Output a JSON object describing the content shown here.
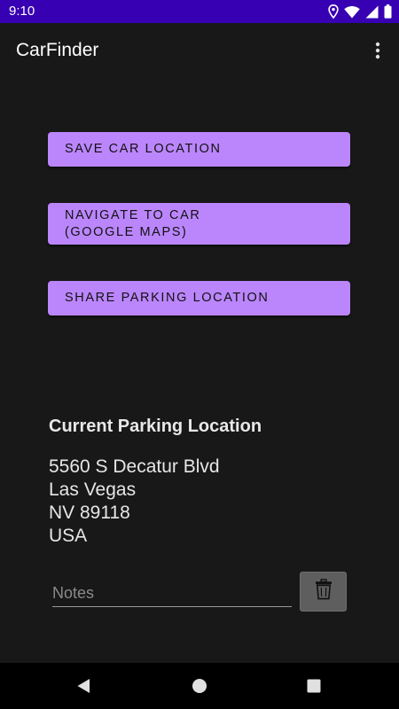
{
  "status_bar": {
    "time": "9:10",
    "icons": [
      "location-icon",
      "wifi-icon",
      "signal-icon",
      "battery-icon"
    ]
  },
  "app_bar": {
    "title": "CarFinder",
    "overflow_icon": "more-vert-icon"
  },
  "actions": {
    "save_label": "Save car location",
    "navigate_label": "Navigate to car\n (Google Maps)",
    "share_label": "Share parking location"
  },
  "parking": {
    "heading": "Current Parking Location",
    "address_lines": [
      "5560 S Decatur Blvd",
      "Las Vegas",
      "NV 89118",
      "USA"
    ],
    "notes_placeholder": "Notes",
    "notes_value": "",
    "delete_icon": "trash-icon"
  },
  "nav_bar": {
    "icons": [
      "back-icon",
      "home-icon",
      "recents-icon"
    ]
  },
  "colors": {
    "status_bar": "#3700b3",
    "background": "#181818",
    "button": "#bb86fc",
    "delete_button": "#5e5e5e",
    "nav_bar": "#000000"
  }
}
